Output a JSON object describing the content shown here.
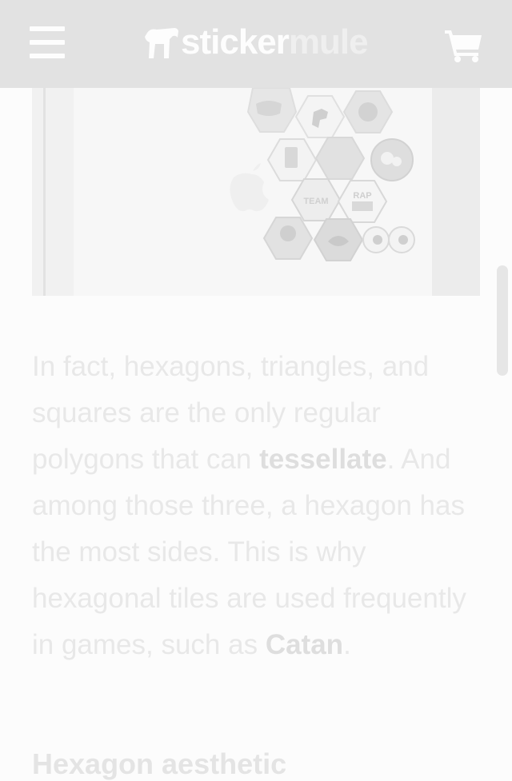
{
  "header": {
    "logo_primary": "sticker",
    "logo_secondary": "mule",
    "menu_icon": "hamburger-menu-icon",
    "cart_icon": "shopping-cart-icon"
  },
  "photo": {
    "sticker_labels": [
      "TEAM",
      "RAP"
    ]
  },
  "article": {
    "para_1_before": "In fact, hexagons, triangles, and squares are the only regular polygons that can ",
    "para_1_link_1": "tessellate",
    "para_1_middle": ". And among those three, a hexagon has the most sides. This is why hexagonal tiles are used frequently in games, such as ",
    "para_1_link_2": "Catan",
    "para_1_end": ".",
    "subheading": "Hexagon aesthetic"
  },
  "colors": {
    "header_bg": "#e2e2e2",
    "page_bg": "#fcfcfc",
    "text": "#e8e8e8"
  }
}
